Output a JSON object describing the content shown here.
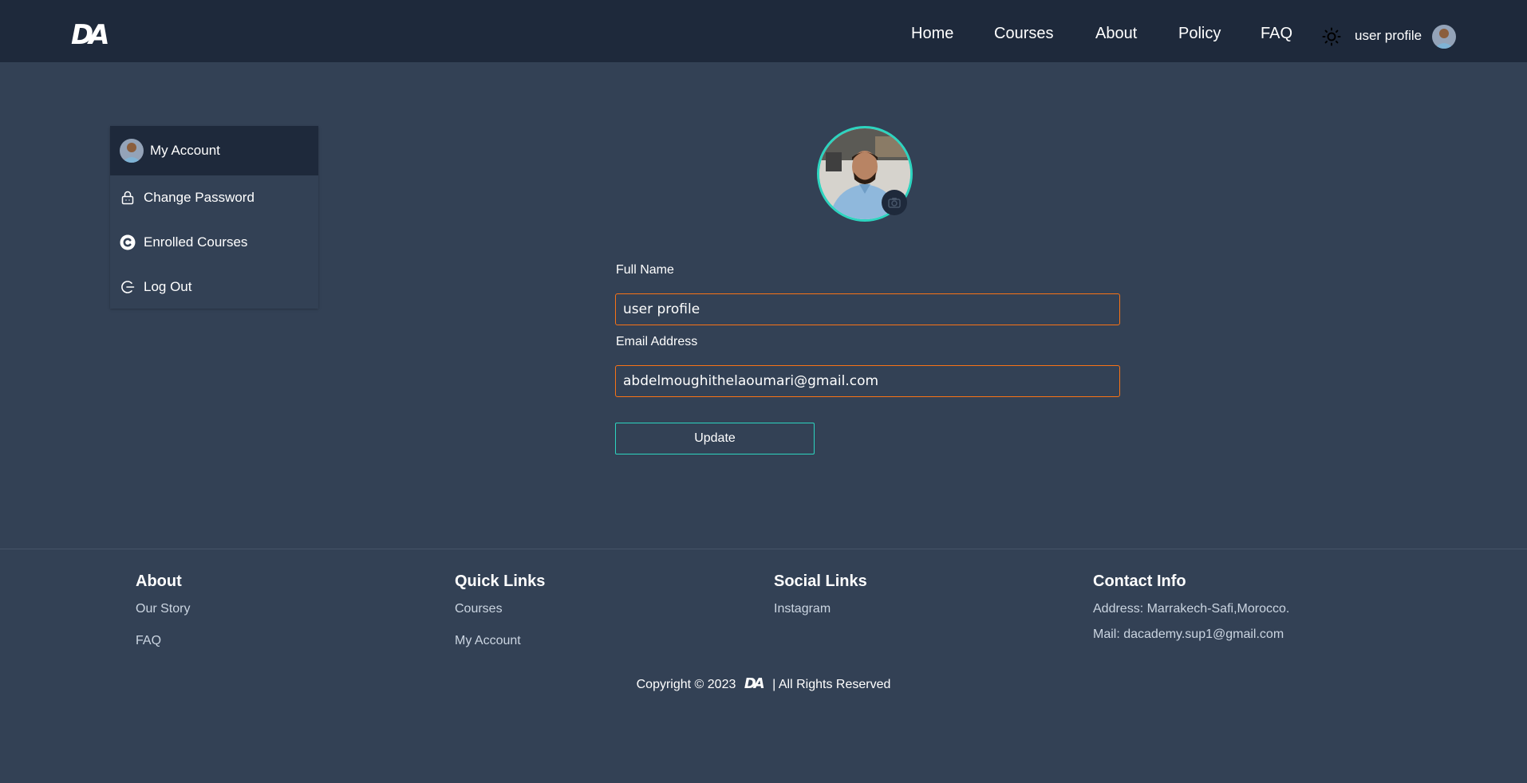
{
  "header": {
    "logo_text": "DA",
    "nav": [
      "Home",
      "Courses",
      "About",
      "Policy",
      "FAQ"
    ],
    "user_name": "user profile"
  },
  "sidebar": {
    "items": [
      {
        "label": "My Account",
        "icon": "avatar"
      },
      {
        "label": "Change Password",
        "icon": "lock-icon"
      },
      {
        "label": "Enrolled Courses",
        "icon": "copyright-c-icon"
      },
      {
        "label": "Log Out",
        "icon": "logout-icon"
      }
    ]
  },
  "form": {
    "full_name_label": "Full Name",
    "full_name_value": "user profile",
    "email_label": "Email Address",
    "email_value": "abdelmoughithelaoumari@gmail.com",
    "update_label": "Update"
  },
  "footer": {
    "about": {
      "title": "About",
      "links": [
        "Our Story",
        "FAQ"
      ]
    },
    "quick_links": {
      "title": "Quick Links",
      "links": [
        "Courses",
        "My Account"
      ]
    },
    "social_links": {
      "title": "Social Links",
      "links": [
        "Instagram"
      ]
    },
    "contact": {
      "title": "Contact Info",
      "address": "Address: Marrakech-Safi,Morocco.",
      "mail": "Mail: dacademy.sup1@gmail.com"
    },
    "copyright_prefix": "Copyright © 2023",
    "copyright_logo": "DA",
    "copyright_suffix": "| All Rights Reserved"
  },
  "colors": {
    "header_bg": "#1e293b",
    "page_bg": "#334155",
    "input_border": "#f97316",
    "accent_teal": "#2dd4bf"
  }
}
